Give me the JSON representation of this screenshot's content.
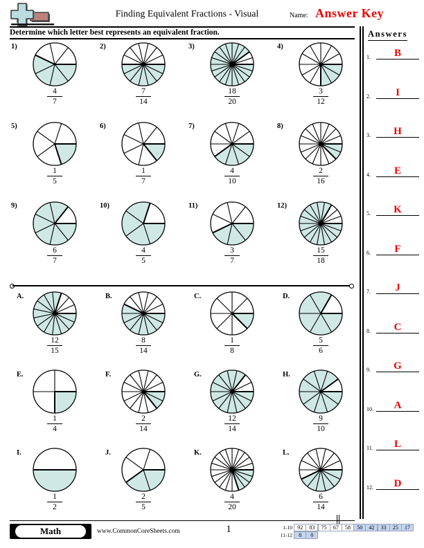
{
  "header": {
    "title": "Finding Equivalent Fractions - Visual",
    "name_label": "Name:",
    "name_value": "Answer Key",
    "instructions": "Determine which letter best represents an equivalent fraction.",
    "logo_icon": "plus-block-logo"
  },
  "answers_panel": {
    "title": "Answers",
    "items": [
      {
        "num": "1.",
        "value": "B"
      },
      {
        "num": "2.",
        "value": "I"
      },
      {
        "num": "3.",
        "value": "H"
      },
      {
        "num": "4.",
        "value": "E"
      },
      {
        "num": "5.",
        "value": "K"
      },
      {
        "num": "6.",
        "value": "F"
      },
      {
        "num": "7.",
        "value": "J"
      },
      {
        "num": "8.",
        "value": "C"
      },
      {
        "num": "9.",
        "value": "G"
      },
      {
        "num": "10.",
        "value": "A"
      },
      {
        "num": "11.",
        "value": "L"
      },
      {
        "num": "12.",
        "value": "D"
      }
    ]
  },
  "problems": [
    {
      "label": "1)",
      "numerator": "4",
      "denominator": "7",
      "slices": 7,
      "shaded": 4
    },
    {
      "label": "2)",
      "numerator": "7",
      "denominator": "14",
      "slices": 14,
      "shaded": 7
    },
    {
      "label": "3)",
      "numerator": "18",
      "denominator": "20",
      "slices": 20,
      "shaded": 18
    },
    {
      "label": "4)",
      "numerator": "3",
      "denominator": "12",
      "slices": 12,
      "shaded": 3
    },
    {
      "label": "5)",
      "numerator": "1",
      "denominator": "5",
      "slices": 5,
      "shaded": 1
    },
    {
      "label": "6)",
      "numerator": "1",
      "denominator": "7",
      "slices": 7,
      "shaded": 1
    },
    {
      "label": "7)",
      "numerator": "4",
      "denominator": "10",
      "slices": 10,
      "shaded": 4
    },
    {
      "label": "8)",
      "numerator": "2",
      "denominator": "16",
      "slices": 16,
      "shaded": 2
    },
    {
      "label": "9)",
      "numerator": "6",
      "denominator": "7",
      "slices": 7,
      "shaded": 6
    },
    {
      "label": "10)",
      "numerator": "4",
      "denominator": "5",
      "slices": 5,
      "shaded": 4
    },
    {
      "label": "11)",
      "numerator": "3",
      "denominator": "7",
      "slices": 7,
      "shaded": 3
    },
    {
      "label": "12)",
      "numerator": "15",
      "denominator": "18",
      "slices": 18,
      "shaded": 15
    }
  ],
  "choices": [
    {
      "label": "A.",
      "numerator": "12",
      "denominator": "15",
      "slices": 15,
      "shaded": 12
    },
    {
      "label": "B.",
      "numerator": "8",
      "denominator": "14",
      "slices": 14,
      "shaded": 8
    },
    {
      "label": "C.",
      "numerator": "1",
      "denominator": "8",
      "slices": 8,
      "shaded": 1
    },
    {
      "label": "D.",
      "numerator": "5",
      "denominator": "6",
      "slices": 6,
      "shaded": 5
    },
    {
      "label": "E.",
      "numerator": "1",
      "denominator": "4",
      "slices": 4,
      "shaded": 1
    },
    {
      "label": "F.",
      "numerator": "2",
      "denominator": "14",
      "slices": 14,
      "shaded": 2
    },
    {
      "label": "G.",
      "numerator": "12",
      "denominator": "14",
      "slices": 14,
      "shaded": 12
    },
    {
      "label": "H.",
      "numerator": "9",
      "denominator": "10",
      "slices": 10,
      "shaded": 9
    },
    {
      "label": "I.",
      "numerator": "1",
      "denominator": "2",
      "slices": 2,
      "shaded": 1
    },
    {
      "label": "J.",
      "numerator": "2",
      "denominator": "5",
      "slices": 5,
      "shaded": 2
    },
    {
      "label": "K.",
      "numerator": "4",
      "denominator": "20",
      "slices": 20,
      "shaded": 4
    },
    {
      "label": "L.",
      "numerator": "6",
      "denominator": "14",
      "slices": 14,
      "shaded": 6
    }
  ],
  "footer": {
    "subject_badge": "Math",
    "website": "www.CommonCoreSheets.com",
    "page_number": "1",
    "score_rows": [
      {
        "label": "1-10",
        "cells": [
          {
            "value": "92",
            "highlight": false
          },
          {
            "value": "83",
            "highlight": false
          },
          {
            "value": "75",
            "highlight": false
          },
          {
            "value": "67",
            "highlight": false
          },
          {
            "value": "58",
            "highlight": false
          },
          {
            "value": "50",
            "highlight": true
          },
          {
            "value": "42",
            "highlight": true
          },
          {
            "value": "33",
            "highlight": true
          },
          {
            "value": "25",
            "highlight": true
          },
          {
            "value": "17",
            "highlight": true
          }
        ]
      },
      {
        "label": "11-12",
        "cells": [
          {
            "value": "8",
            "highlight": true
          },
          {
            "value": "0",
            "highlight": true
          }
        ]
      }
    ]
  },
  "style": {
    "pie_fill": "#cfe8e4",
    "answer_red": "#ee0000",
    "score_highlight": "#c5d4ef"
  }
}
